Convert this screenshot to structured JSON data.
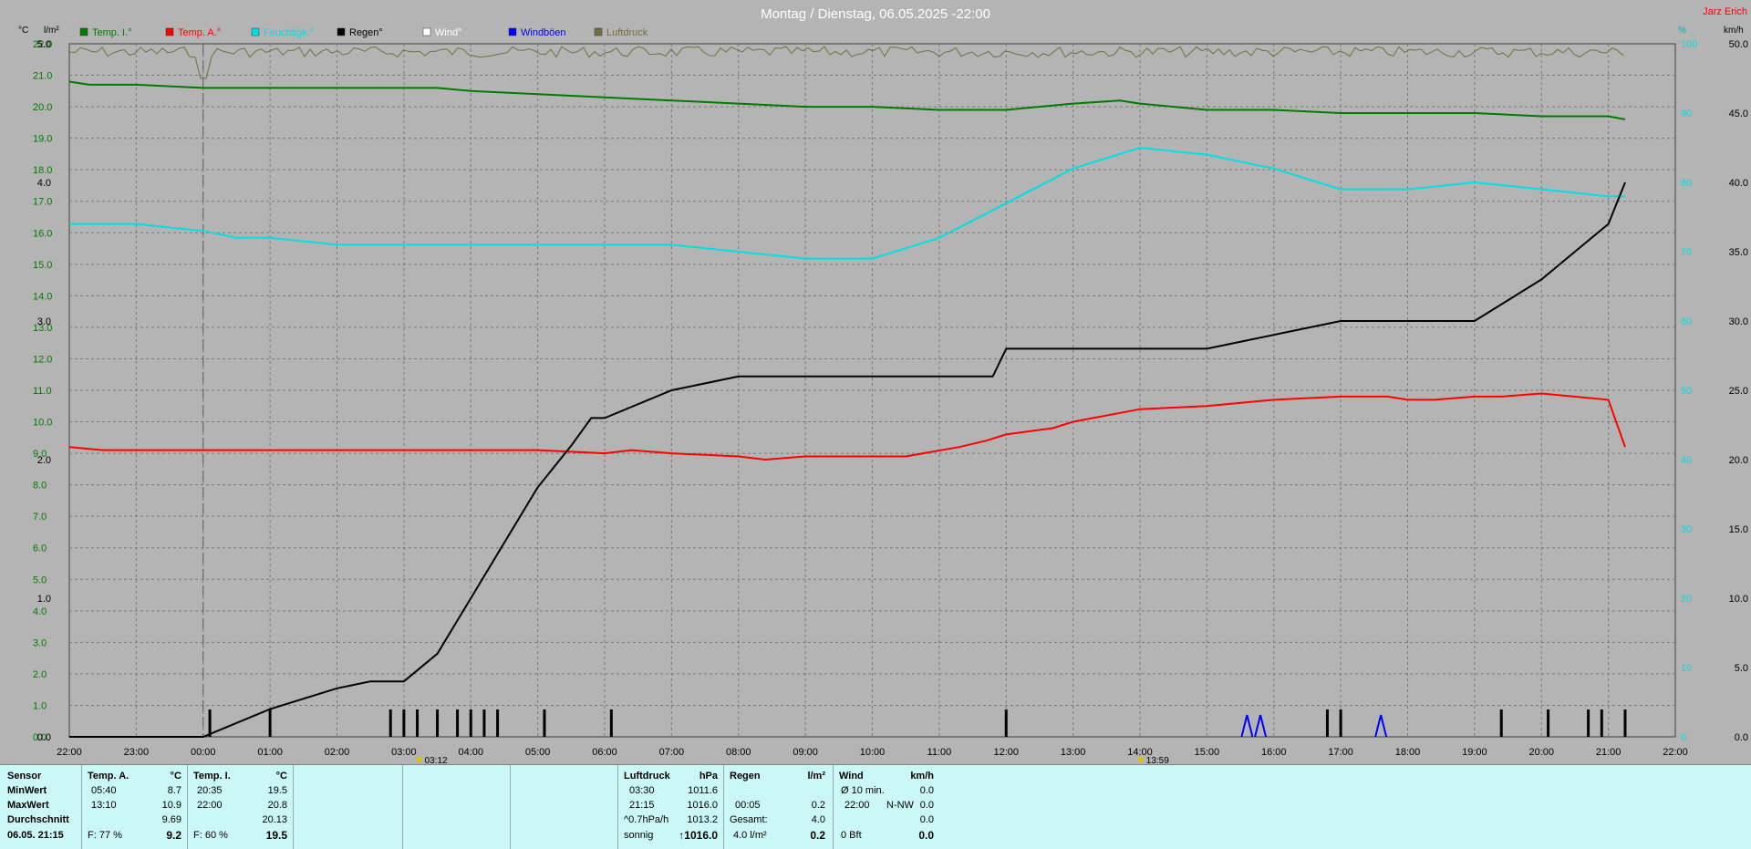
{
  "header": {
    "title": "Montag / Dienstag, 06.05.2025  -22:00",
    "author": "Jarz Erich"
  },
  "colors": {
    "temp_inside": "#007a00",
    "temp_outside": "#ff0000",
    "humidity": "#00e0e0",
    "rain": "#000000",
    "wind": "#ffffff",
    "gust": "#0000ff",
    "pressure": "#707040"
  },
  "chart_data": {
    "type": "line",
    "x_unit": "hour",
    "x_range": [
      "22:00",
      "22:00"
    ],
    "x_ticks": [
      "22:00",
      "23:00",
      "00:00",
      "01:00",
      "02:00",
      "03:00",
      "04:00",
      "05:00",
      "06:00",
      "07:00",
      "08:00",
      "09:00",
      "10:00",
      "11:00",
      "12:00",
      "13:00",
      "14:00",
      "15:00",
      "16:00",
      "17:00",
      "18:00",
      "19:00",
      "20:00",
      "21:00",
      "22:00"
    ],
    "markers": [
      {
        "time": "03:12",
        "label": "03:12"
      },
      {
        "time": "13:59",
        "label": "13:59"
      }
    ],
    "axes": {
      "left_temp": {
        "unit": "°C",
        "range": [
          0,
          22
        ],
        "ticks": [
          "0.0",
          "1.0",
          "2.0",
          "3.0",
          "4.0",
          "5.0",
          "6.0",
          "7.0",
          "8.0",
          "9.0",
          "10.0",
          "11.0",
          "12.0",
          "13.0",
          "14.0",
          "15.0",
          "16.0",
          "17.0",
          "18.0",
          "19.0",
          "20.0",
          "21.0",
          "22.0"
        ]
      },
      "left_rain": {
        "unit": "l/m²",
        "range": [
          0,
          5
        ],
        "ticks": [
          "0.0",
          "1.0",
          "2.0",
          "3.0",
          "4.0",
          "5.0"
        ]
      },
      "right_humidity": {
        "unit": "%",
        "range": [
          0,
          100
        ],
        "ticks": [
          "0",
          "10",
          "20",
          "30",
          "40",
          "50",
          "60",
          "70",
          "80",
          "90",
          "100"
        ]
      },
      "right_wind": {
        "unit": "km/h",
        "range": [
          0,
          50
        ],
        "ticks": [
          "0.0",
          "5.0",
          "10.0",
          "15.0",
          "20.0",
          "25.0",
          "30.0",
          "35.0",
          "40.0",
          "45.0",
          "50.0"
        ]
      }
    },
    "legend": [
      "Temp. I.°",
      "Temp. A.°",
      "Feuchtigk.°",
      "Regen°",
      "Wind°",
      "Windböen",
      "Luftdruck"
    ],
    "grid": true,
    "series": [
      {
        "name": "Temp. I.°",
        "axis": "left_temp",
        "color": "#007a00",
        "x": [
          0,
          0.3,
          1,
          2,
          4,
          5.5,
          6,
          7,
          8,
          9,
          10,
          11,
          12,
          13,
          14,
          15,
          15.7,
          16,
          17,
          18,
          19,
          20,
          21,
          22,
          23,
          23.25
        ],
        "y": [
          20.8,
          20.7,
          20.7,
          20.6,
          20.6,
          20.6,
          20.5,
          20.4,
          20.3,
          20.2,
          20.1,
          20.0,
          20.0,
          19.9,
          19.9,
          20.1,
          20.2,
          20.1,
          19.9,
          19.9,
          19.8,
          19.8,
          19.8,
          19.7,
          19.7,
          19.6
        ]
      },
      {
        "name": "Temp. A.°",
        "axis": "left_temp",
        "color": "#ff0000",
        "x": [
          0,
          0.5,
          2,
          4,
          6,
          7,
          8,
          8.4,
          9,
          10,
          10.4,
          11,
          11.8,
          12.5,
          13.3,
          13.7,
          14,
          14.7,
          15,
          16,
          17,
          18,
          19,
          19.7,
          20,
          20.4,
          21,
          21.4,
          22,
          23,
          23.25
        ],
        "y": [
          9.2,
          9.1,
          9.1,
          9.1,
          9.1,
          9.1,
          9.0,
          9.1,
          9.0,
          8.9,
          8.8,
          8.9,
          8.9,
          8.9,
          9.2,
          9.4,
          9.6,
          9.8,
          10.0,
          10.4,
          10.5,
          10.7,
          10.8,
          10.8,
          10.7,
          10.7,
          10.8,
          10.8,
          10.9,
          10.7,
          9.2
        ]
      },
      {
        "name": "Feuchtigk.°",
        "axis": "right_humidity",
        "color": "#00e0e0",
        "x": [
          0,
          1,
          2,
          2.5,
          3,
          4,
          5,
          6,
          7,
          8,
          9,
          10,
          11,
          12,
          13,
          14,
          15,
          16,
          17,
          18,
          19,
          20,
          21,
          22,
          23,
          23.25
        ],
        "y": [
          74,
          74,
          73,
          72,
          72,
          71,
          71,
          71,
          71,
          71,
          71,
          70,
          69,
          69,
          72,
          77,
          82,
          85,
          84,
          82,
          79,
          79,
          80,
          79,
          78,
          78
        ]
      },
      {
        "name": "Regen°",
        "axis": "left_rain",
        "color": "#000000",
        "x": [
          0,
          2,
          2.5,
          3,
          3,
          4,
          4.5,
          5,
          5.5,
          6,
          6.5,
          7,
          7.5,
          7.8,
          8,
          9,
          10,
          11,
          12,
          13,
          13.5,
          13.8,
          14,
          15,
          16,
          16.5,
          16.8,
          17,
          18,
          19,
          20,
          20.5,
          21,
          22,
          22.5,
          23,
          23.25
        ],
        "y": [
          0,
          0,
          0.1,
          0.2,
          0.2,
          0.35,
          0.4,
          0.4,
          0.6,
          1.0,
          1.4,
          1.8,
          2.1,
          2.3,
          2.3,
          2.5,
          2.6,
          2.6,
          2.6,
          2.6,
          2.6,
          2.6,
          2.8,
          2.8,
          2.8,
          2.8,
          2.8,
          2.8,
          2.9,
          3.0,
          3.0,
          3.0,
          3.0,
          3.3,
          3.5,
          3.7,
          4.0
        ]
      }
    ],
    "rain_events": [
      2.1,
      3.0,
      4.8,
      5.0,
      5.2,
      5.5,
      5.8,
      6.0,
      6.2,
      6.4,
      7.1,
      8.1,
      14.0,
      18.8,
      19.0,
      21.4,
      22.1,
      22.7,
      22.9,
      23.25
    ],
    "gust_events": [
      17.6,
      17.8,
      19.6
    ]
  },
  "panel": {
    "sensor": {
      "header": "Sensor",
      "rows": [
        "MinWert",
        "MaxWert",
        "Durchschnitt"
      ],
      "date": "06.05. 21:15"
    },
    "temp_a": {
      "header": "Temp. A.",
      "unit": "°C",
      "min_time": "05:40",
      "min": "8.7",
      "max_time": "13:10",
      "max": "10.9",
      "avg": "9.69",
      "rh_label": "F: 77 %",
      "current": "9.2"
    },
    "temp_i": {
      "header": "Temp. I.",
      "unit": "°C",
      "min_time": "20:35",
      "min": "19.5",
      "max_time": "22:00",
      "max": "20.8",
      "avg": "20.13",
      "rh_label": "F: 60 %",
      "current": "19.5"
    },
    "pressure": {
      "header": "Luftdruck",
      "unit": "hPa",
      "min_time": "03:30",
      "min": "1011.6",
      "max_time": "21:15",
      "max": "1016.0",
      "trend": "^0.7hPa/h",
      "avg": "1013.2",
      "state": "sonnig",
      "current": "↑1016.0"
    },
    "rain": {
      "header": "Regen",
      "unit": "l/m²",
      "time1": "00:05",
      "val1": "0.2",
      "total_label": "Gesamt:",
      "total": "4.0",
      "footer": "4.0 l/m²",
      "current": "0.2"
    },
    "wind": {
      "header": "Wind",
      "unit": "km/h",
      "row1_label": "Ø 10 min.",
      "row1_val": "0.0",
      "row2_time": "22:00",
      "row2_dir": "N-NW",
      "row2_val": "0.0",
      "row3_val": "0.0",
      "bft": "0 Bft",
      "current": "0.0"
    }
  }
}
